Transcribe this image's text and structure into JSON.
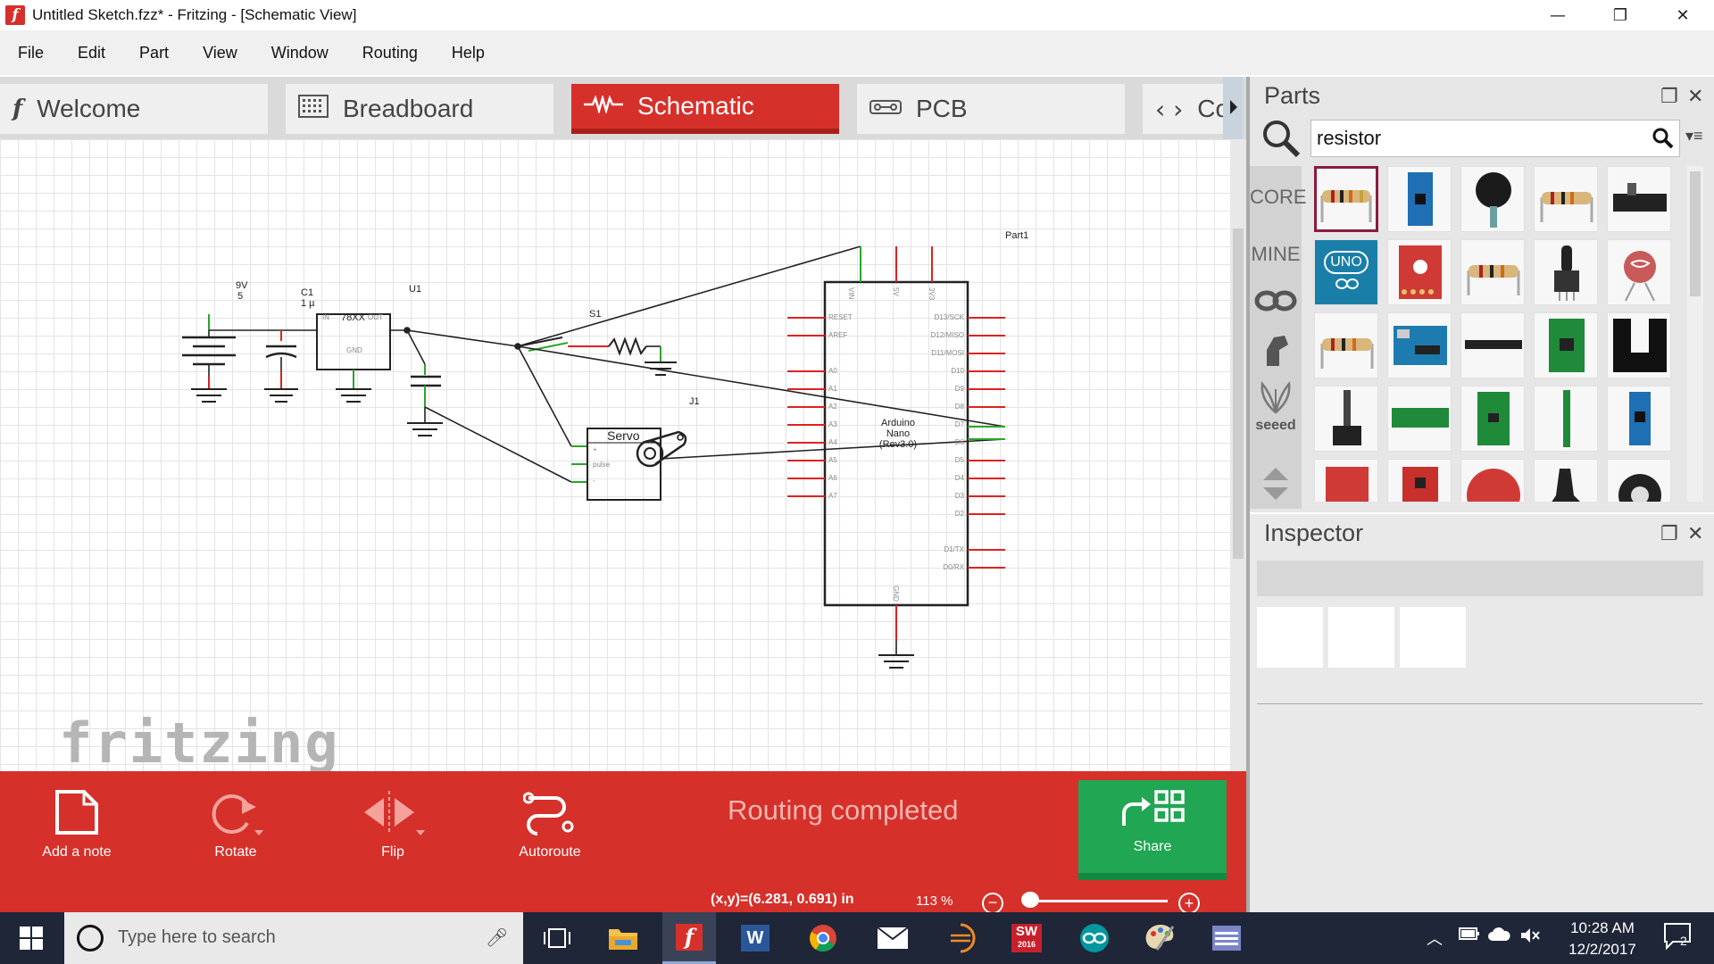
{
  "window": {
    "title": "Untitled Sketch.fzz* - Fritzing - [Schematic View]",
    "app_icon": "f",
    "minimize": "—",
    "maximize": "❐",
    "close": "✕"
  },
  "menu": [
    "File",
    "Edit",
    "Part",
    "View",
    "Window",
    "Routing",
    "Help"
  ],
  "tabs": [
    {
      "label": "Welcome",
      "icon": "fritzing-f-icon",
      "glyph": "f"
    },
    {
      "label": "Breadboard",
      "icon": "breadboard-icon",
      "glyph": "▦"
    },
    {
      "label": "Schematic",
      "icon": "schematic-wave-icon",
      "glyph": "⏦"
    },
    {
      "label": "PCB",
      "icon": "pcb-icon",
      "glyph": "▭"
    },
    {
      "label": "Code",
      "icon": "code-brackets-icon",
      "glyph": "<>"
    }
  ],
  "active_tab": "Schematic",
  "canvas": {
    "watermark": "fritzing",
    "labels": {
      "battery_name": "9V",
      "battery_value": "5",
      "cap_name": "C1",
      "cap_value": "1 µ",
      "regulator_ref": "U1",
      "regulator_part": "78XX",
      "regulator_in": "IN",
      "regulator_out": "OUT",
      "regulator_gnd": "GND",
      "switch_ref": "S1",
      "servo_ref": "J1",
      "servo_name": "Servo",
      "servo_pin_pulse": "pulse",
      "servo_pin_plus": "+",
      "servo_pin_minus": "-",
      "arduino_ref": "Part1",
      "arduino_name_line1": "Arduino",
      "arduino_name_line2": "Nano",
      "arduino_name_line3": "(Rev3.0)",
      "arduino_top_pins": [
        "VIN",
        "5V",
        "3V3"
      ],
      "arduino_bottom_pin": "GND",
      "arduino_left_pins": [
        "RESET",
        "AREF",
        "A0",
        "A1",
        "A2",
        "A3",
        "A4",
        "A5",
        "A6",
        "A7"
      ],
      "arduino_right_pins": [
        "D13/SCK",
        "D12/MISO",
        "D11/MOSI",
        "D10",
        "D9",
        "D8",
        "D7",
        "D6",
        "D5",
        "D4",
        "D3",
        "D2",
        "D1/TX",
        "D0/RX"
      ]
    }
  },
  "toolbar": {
    "add_note": "Add a note",
    "rotate": "Rotate",
    "flip": "Flip",
    "autoroute": "Autoroute",
    "routing_status": "Routing completed",
    "share": "Share"
  },
  "statusbar": {
    "coordinates": "(x,y)=(6.281, 0.691) in",
    "zoom": "113 %",
    "zoom_out": "−",
    "zoom_in": "+",
    "zoom_slider_level": 0.0
  },
  "parts": {
    "title": "Parts",
    "search_value": "resistor",
    "bins": [
      "CORE",
      "MINE"
    ],
    "bin_icons": [
      "arduino-infinity-icon",
      "fritzing-hand-icon",
      "seeed-logo-icon",
      "scroll-arrows-icon"
    ],
    "seeed_label": "seeed",
    "uno_label": "UNO",
    "float": "❐",
    "close": "✕"
  },
  "inspector": {
    "title": "Inspector",
    "float": "❐",
    "close": "✕"
  },
  "taskbar": {
    "search_placeholder": "Type here to search",
    "time": "10:28 AM",
    "date": "12/2/2017",
    "notifications": "2",
    "sw_label": "SW",
    "sw_year": "2016",
    "word_label": "W",
    "fritzing_label": "f"
  },
  "colors": {
    "accent_red": "#d6302a",
    "share_green": "#21a654",
    "taskbar": "#1f2638"
  }
}
